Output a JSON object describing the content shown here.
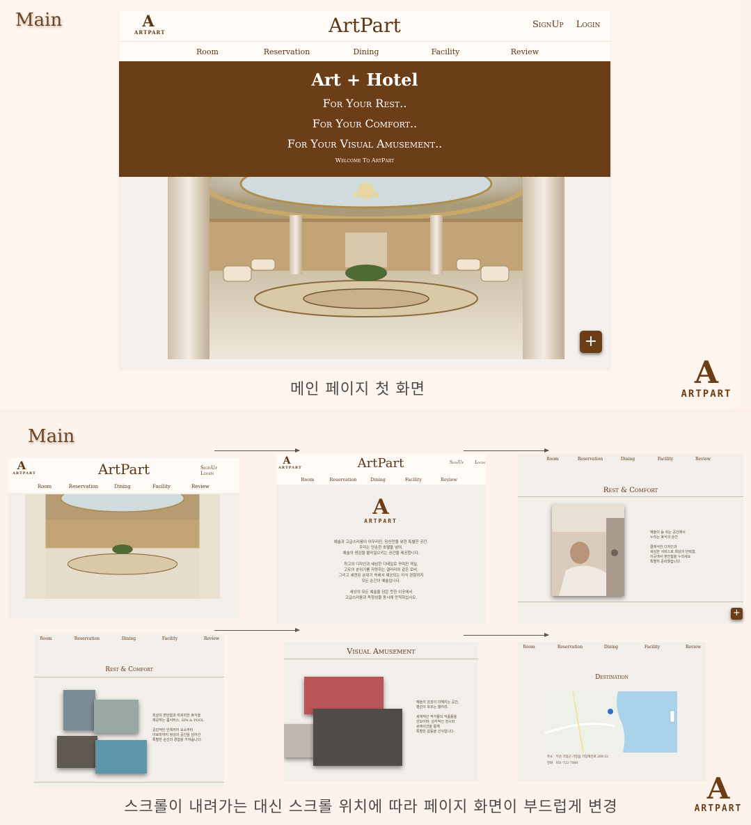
{
  "section_label": "Main",
  "brand": {
    "mark": "A",
    "wordmark": "ARTPART",
    "site_title": "ArtPart"
  },
  "header": {
    "signup": "SignUp",
    "login": "Login"
  },
  "nav": [
    "Room",
    "Reservation",
    "Dining",
    "Facility",
    "Review"
  ],
  "hero": {
    "title": "Art + Hotel",
    "line1": "For Your Rest..",
    "line2": "For Your Comfort..",
    "line3": "For Your Visual Amusement..",
    "welcome": "Welcome To ArtPart"
  },
  "plus_label": "+",
  "caption_top": "메인 페이지 첫 화면",
  "caption_bottom": "스크롤이 내려가는 대신 스크롤 위치에 따라 페이지 화면이 부드럽게 변경",
  "intro": {
    "lines": [
      "예술과 고급스러움이 어우러진, 당신만을 위한 특별한 공간.",
      "우리는 단순한 호텔을 넘어,",
      "예술의 영감을 불러일으키는 공간을 제공합니다.",
      "",
      "최고의 디자인과 세심한 디테일로 꾸며진 객실,",
      "고유의 분위기를 자랑하는 갤러리와 같은 로비,",
      "그리고 세련된 분위기 속에서 제공되는 미식 경험까지",
      "모든 순간이 예술입니다.",
      "",
      "세상의 모든 예술을 담은 듯한 이곳에서",
      "고급스러움과 독창성을 동시에 만끽하십시오."
    ]
  },
  "rest_comfort": {
    "title": "Rest & Comfort",
    "side_a": [
      "예술이 숨 쉬는 공간에서",
      "누리는 휴식의 순간",
      "",
      "클래식한 디자인과",
      "세심한 서비스로 최상의 안락함,",
      "이곳에서 편안함을 누리세요",
      "특별히 준비했습니다."
    ],
    "side_b": [
      "최상의 편안함과 럭셔리한 휴식을",
      "제공하는 룸서비스, SPA & POOL",
      "",
      "공감적인 인테리어 요소부터",
      "아로마까지 정성의 공간을 넘어선",
      "특별한 순간의 경험을 가져옵니다."
    ]
  },
  "visual": {
    "title": "Visual Amusement",
    "side": [
      "예술의 감성이 더해지는 공간,",
      "영감이 흐르는 갤러리.",
      "",
      "세계적인 작가들의 작품들을",
      "선보이며, 감각적인 전시와",
      "큐레이션을 통해",
      "특별한 감동을 선사합니다."
    ]
  },
  "destination": {
    "title": "Destination",
    "address_label": "주소",
    "address_value": "부산 기장군 기장읍 기장해안로 268-32",
    "phone_label": "전화",
    "phone_value": "051-722-7000"
  },
  "colors": {
    "brand_brown": "#6b3e17",
    "page_bg": "#fdf3ec",
    "panel_bg": "#f2eee9"
  }
}
